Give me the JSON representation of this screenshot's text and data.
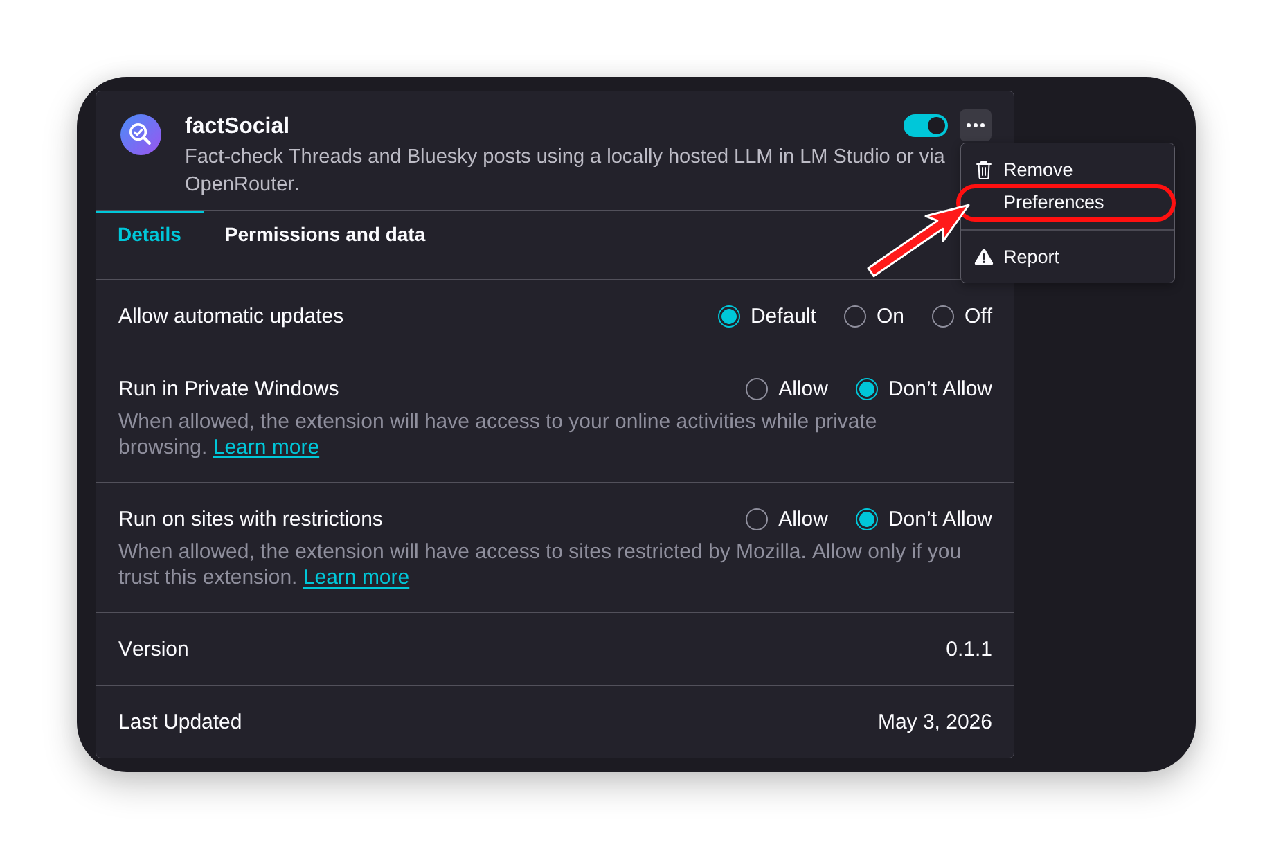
{
  "extension": {
    "name": "factSocial",
    "description": "Fact-check Threads and Bluesky posts using a locally hosted LLM in LM Studio or via OpenRouter.",
    "enabled": true
  },
  "more_menu": {
    "open": true,
    "groups": [
      {
        "items": [
          {
            "label": "Remove",
            "highlighted": false
          },
          {
            "label": "Preferences",
            "highlighted": true
          }
        ]
      },
      {
        "items": [
          {
            "label": "Report",
            "highlighted": false
          }
        ]
      }
    ]
  },
  "tabs": [
    {
      "label": "Details",
      "selected": true
    },
    {
      "label": "Permissions and data",
      "selected": false
    }
  ],
  "settings": [
    {
      "kind": "choice",
      "label": "Allow automatic updates",
      "options": [
        {
          "label": "Default",
          "selected": true
        },
        {
          "label": "On",
          "selected": false
        },
        {
          "label": "Off",
          "selected": false
        }
      ]
    },
    {
      "kind": "choice",
      "label": "Run in Private Windows",
      "options": [
        {
          "label": "Allow",
          "selected": false
        },
        {
          "label": "Don’t Allow",
          "selected": true
        }
      ],
      "description": "When allowed, the extension will have access to your online activities while private browsing.",
      "link": "Learn more"
    },
    {
      "kind": "choice",
      "label": "Run on sites with restrictions",
      "options": [
        {
          "label": "Allow",
          "selected": false
        },
        {
          "label": "Don’t Allow",
          "selected": true
        }
      ],
      "description": "When allowed, the extension will have access to sites restricted by Mozilla. Allow only if you trust this extension.",
      "link": "Learn more"
    },
    {
      "kind": "info",
      "label": "Version",
      "value": "0.1.1"
    },
    {
      "kind": "info",
      "label": "Last Updated",
      "value": "May 3, 2026"
    }
  ]
}
